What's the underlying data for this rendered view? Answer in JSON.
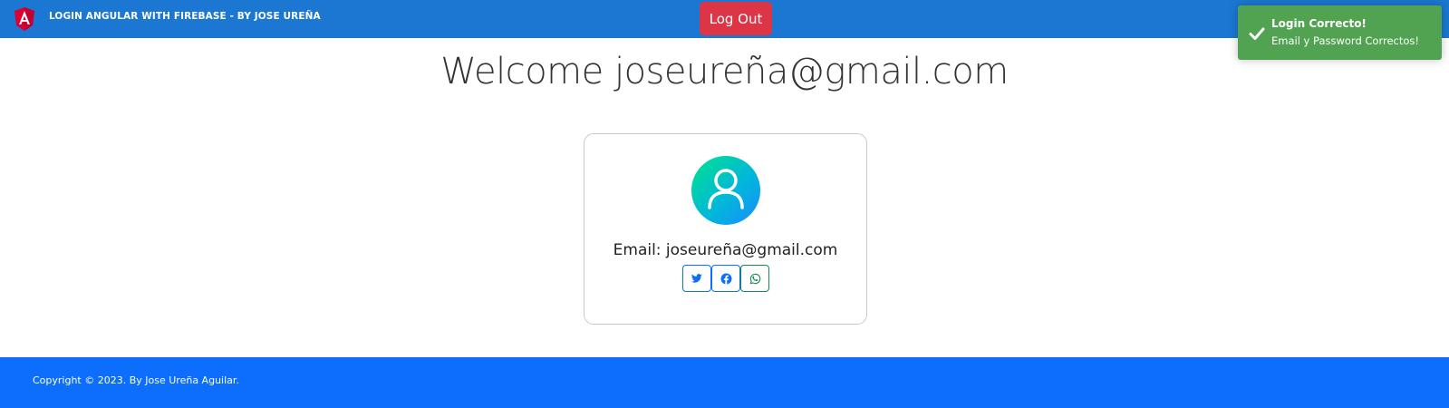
{
  "navbar": {
    "logo_icon": "angular-logo-icon",
    "title": "LOGIN ANGULAR WITH FIREBASE - BY JOSE UREÑA",
    "logout_label": "Log Out",
    "bg_color": "#1b77d2"
  },
  "toast": {
    "icon": "checkmark-icon",
    "title": "Login Correcto!",
    "message": "Email y Password Correctos!",
    "bg_color": "#51a351"
  },
  "main": {
    "welcome": "Welcome joseureña@gmail.com",
    "card": {
      "avatar_icon": "user-avatar-icon",
      "email_line": "Email: joseureña@gmail.com",
      "social": [
        {
          "icon": "twitter-icon",
          "color": "#0d6efd"
        },
        {
          "icon": "facebook-icon",
          "color": "#0d6efd"
        },
        {
          "icon": "whatsapp-icon",
          "color": "#198754"
        }
      ]
    }
  },
  "footer": {
    "text": "Copyright © 2023. By Jose Ureña Aguilar.",
    "bg_color": "#0d6efd"
  }
}
